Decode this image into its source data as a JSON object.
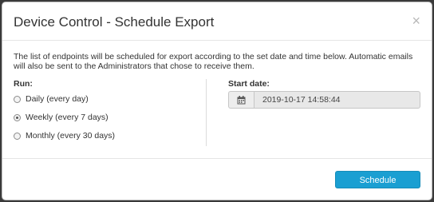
{
  "dialog": {
    "title": "Device Control - Schedule Export",
    "close_label": "×",
    "description": "The list of endpoints will be scheduled for export according to the set date and time below. Automatic emails will also be sent to the Administrators that chose to receive them."
  },
  "run": {
    "label": "Run:",
    "options": [
      {
        "label": "Daily (every day)",
        "checked": false
      },
      {
        "label": "Weekly (every 7 days)",
        "checked": true
      },
      {
        "label": "Monthly (every 30 days)",
        "checked": false
      }
    ]
  },
  "start": {
    "label": "Start date:",
    "value": "2019-10-17 14:58:44",
    "icon": "calendar-icon"
  },
  "footer": {
    "schedule_label": "Schedule"
  },
  "colors": {
    "accent": "#1a9fd2",
    "overlay": "#3a3a3a"
  }
}
